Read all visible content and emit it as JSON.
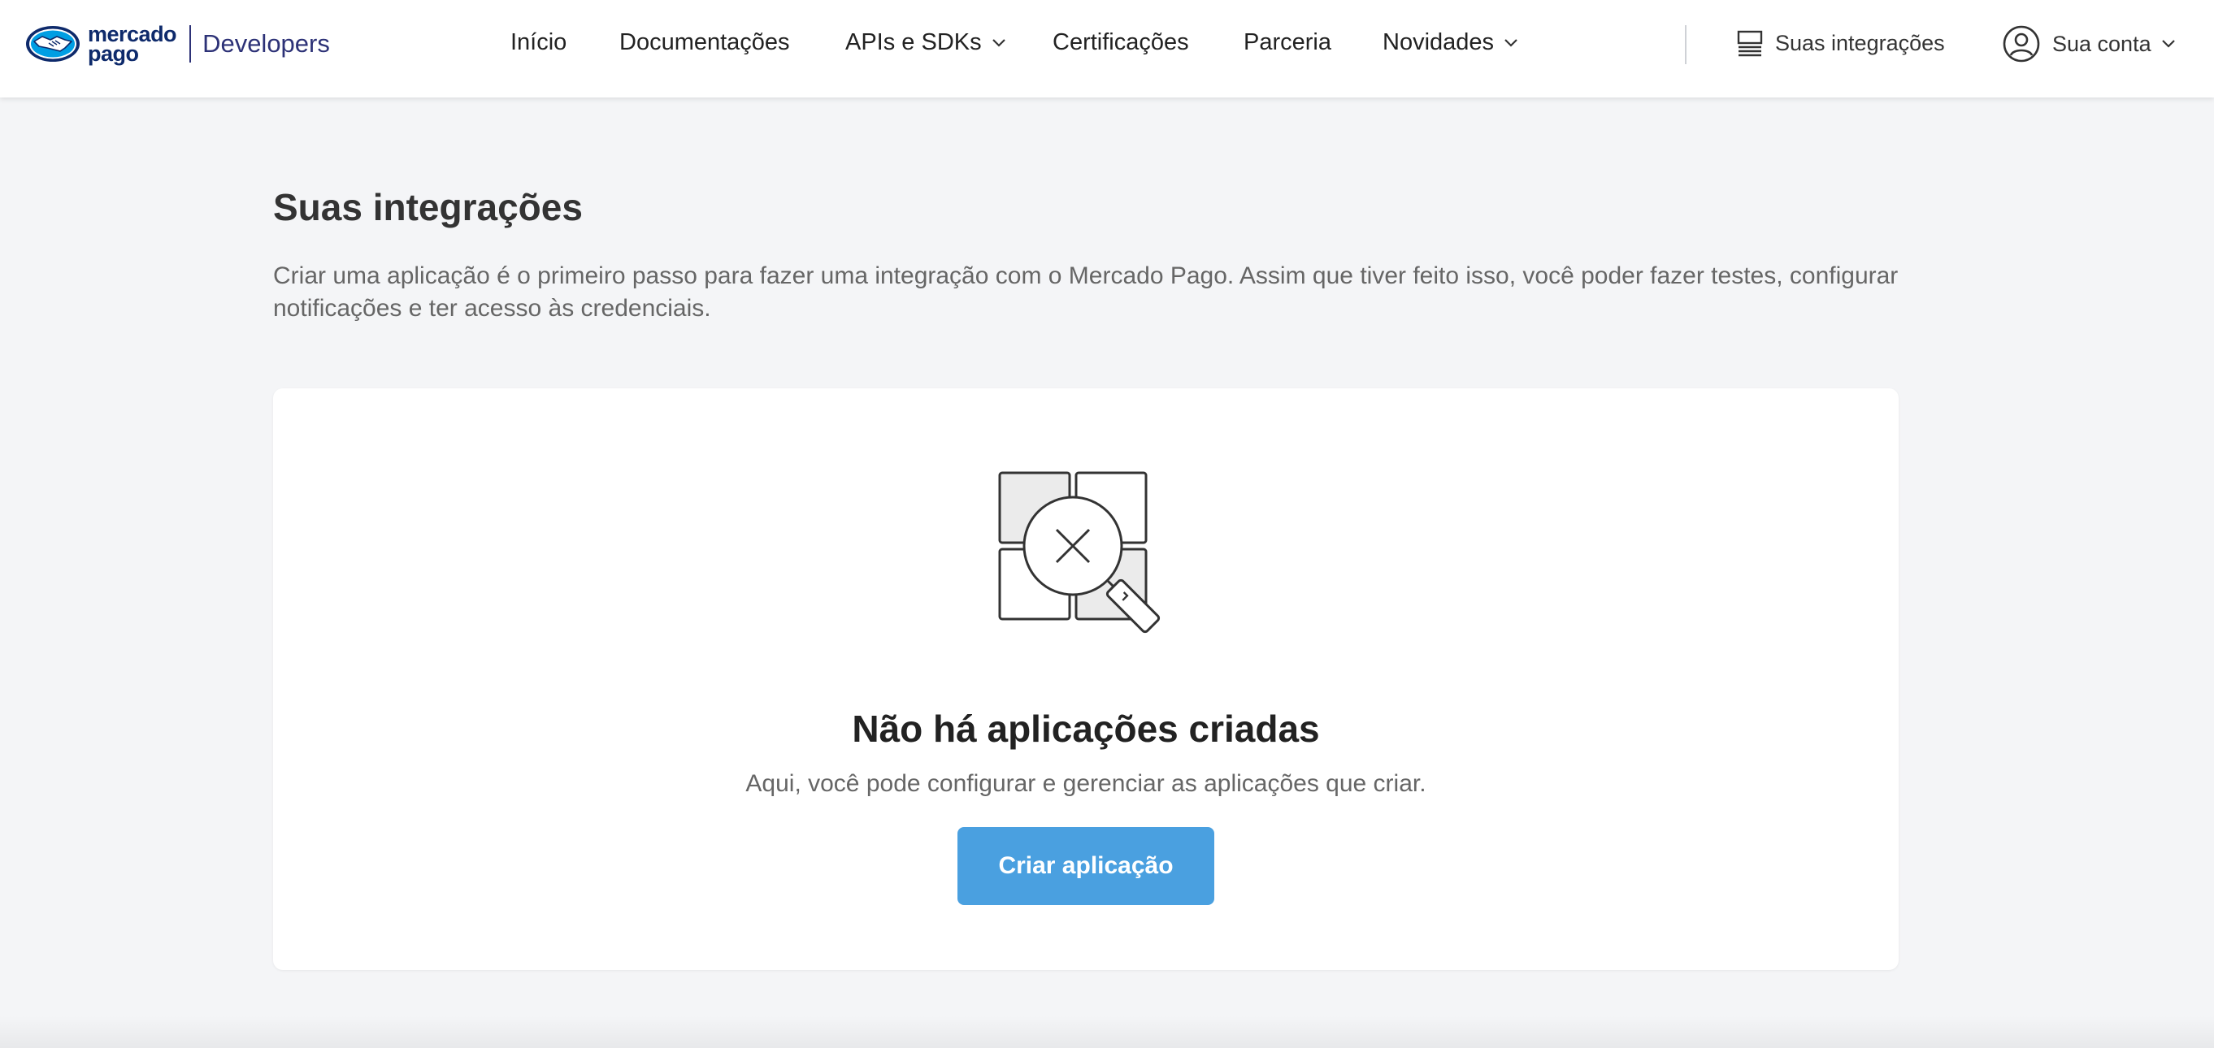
{
  "header": {
    "logo_line1": "mercado",
    "logo_line2": "pago",
    "brand_suffix": "Developers",
    "nav": [
      {
        "label": "Início"
      },
      {
        "label": "Documentações"
      },
      {
        "label": "APIs e SDKs"
      },
      {
        "label": "Certificações"
      },
      {
        "label": "Parceria"
      },
      {
        "label": "Novidades"
      }
    ],
    "integrations_link": "Suas integrações",
    "account": "Sua conta"
  },
  "main": {
    "title": "Suas integrações",
    "description": "Criar uma aplicação é o primeiro passo para fazer uma integração com o Mercado Pago. Assim que tiver feito isso, você poder fazer testes, configurar notificações e ter acesso às credenciais.",
    "empty_state": {
      "title": "Não há aplicações criadas",
      "subtitle": "Aqui, você pode configurar e gerenciar as aplicações que criar.",
      "button": "Criar aplicação"
    }
  },
  "colors": {
    "brand_navy": "#2d3277",
    "primary_button": "#4aa0e0",
    "logo_blue": "#009ee3",
    "page_background": "#f4f5f7"
  },
  "icons": {
    "logo": "mercado-pago-handshake",
    "chevron": "chevron-down",
    "integrations": "list-icon",
    "account": "user-circle",
    "illustration": "magnifier-with-x-over-grid"
  }
}
